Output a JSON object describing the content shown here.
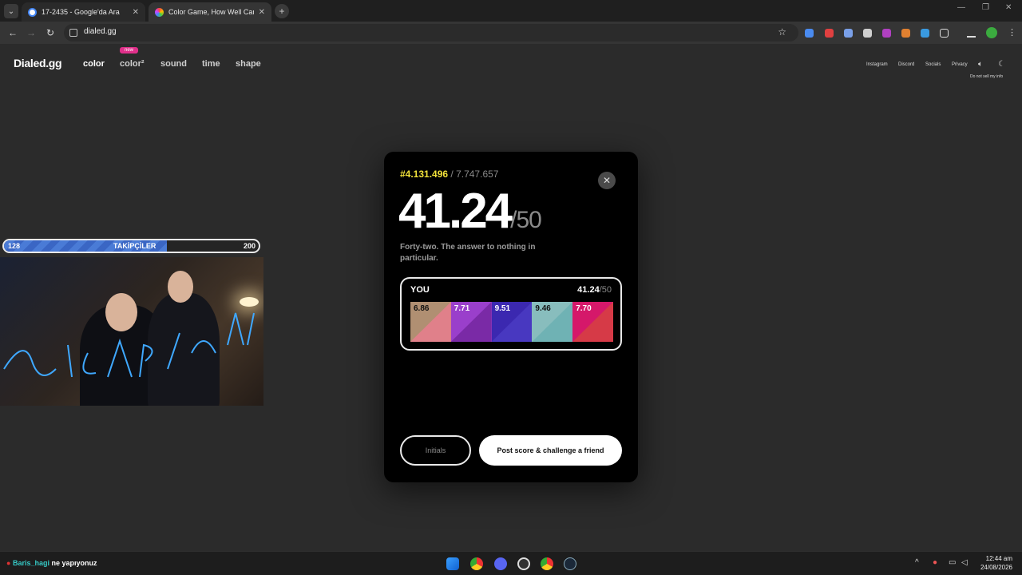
{
  "browser": {
    "tabs": [
      {
        "title": "17-2435 - Google'da Ara",
        "active": false
      },
      {
        "title": "Color Game, How Well Can You",
        "active": true
      }
    ],
    "url": "dialed.gg"
  },
  "site": {
    "logo": "Dialed.gg",
    "nav": [
      {
        "label": "color",
        "active": true
      },
      {
        "label": "color²",
        "active": false
      },
      {
        "label": "sound",
        "active": false
      },
      {
        "label": "time",
        "active": false
      },
      {
        "label": "shape",
        "active": false
      }
    ],
    "new_badge": "new",
    "top_links": [
      "Instagram",
      "Discord",
      "Socials",
      "Privacy"
    ],
    "do_not_sell": "Do not sell my info"
  },
  "stream_overlay": {
    "follow_current": "128",
    "follow_goal": "200",
    "follow_label": "TAKİPÇİLER",
    "follow_progress": 0.64
  },
  "result": {
    "rank": "#4.131.496",
    "total_players": "/ 7.747.657",
    "score": "41.24",
    "score_max": "/50",
    "comment": "Forty-two. The answer to nothing in particular.",
    "card_label": "YOU",
    "card_score": "41.24",
    "card_max": "/50",
    "rounds": [
      {
        "score": "6.86",
        "target": "#b08f72",
        "guess": "#e0808a"
      },
      {
        "score": "7.71",
        "target": "#9a3fcb",
        "guess": "#7a2aa6"
      },
      {
        "score": "9.51",
        "target": "#3b28b0",
        "guess": "#4838c0"
      },
      {
        "score": "9.46",
        "target": "#88bdbd",
        "guess": "#6fb2b4"
      },
      {
        "score": "7.70",
        "target": "#d5186a",
        "guess": "#d63a47"
      }
    ],
    "initials_button": "Initials",
    "post_button": "Post score & challenge a friend"
  },
  "taskbar": {
    "chat_user": "Baris_hagi",
    "chat_message": "ne yapıyonuz",
    "time": "12:44 am",
    "date": "24/08/2026"
  }
}
